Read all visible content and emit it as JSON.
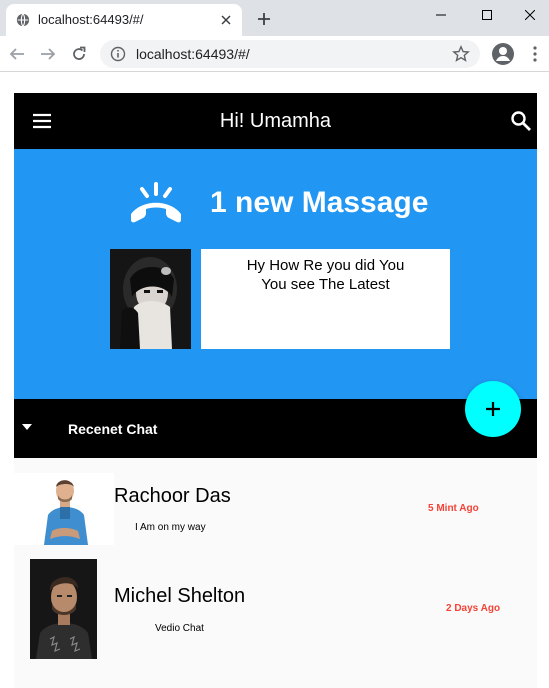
{
  "browser": {
    "tab_title": "localhost:64493/#/",
    "url": "localhost:64493/#/",
    "icons": [
      "globe-icon",
      "close-icon",
      "plus-icon",
      "minimize-icon",
      "maximize-icon",
      "close-icon",
      "back-arrow-icon",
      "forward-arrow-icon",
      "reload-icon",
      "info-icon",
      "star-icon",
      "profile-icon",
      "more-vert-icon"
    ]
  },
  "appbar": {
    "title": "Hi! Umamha",
    "menu_icon": "hamburger-menu-icon",
    "search_icon": "search-icon"
  },
  "hero": {
    "icon": "ringing-phone-icon",
    "title": "1 new Massage",
    "message_line_1": "Hy How Re you did You",
    "message_line_2": "You see The Latest"
  },
  "recent": {
    "label": "Recenet Chat",
    "caret_icon": "caret-down-icon"
  },
  "fab": {
    "icon": "plus-icon"
  },
  "chats": [
    {
      "name": "Rachoor Das",
      "message": "I Am on my way",
      "time": "5 Mint Ago"
    },
    {
      "name": "Michel Shelton",
      "message": "Vedio Chat",
      "time": "2 Days Ago"
    }
  ],
  "colors": {
    "appbar": "#000000",
    "hero": "#2196f3",
    "fab": "#00ffff",
    "time": "#f44336"
  }
}
